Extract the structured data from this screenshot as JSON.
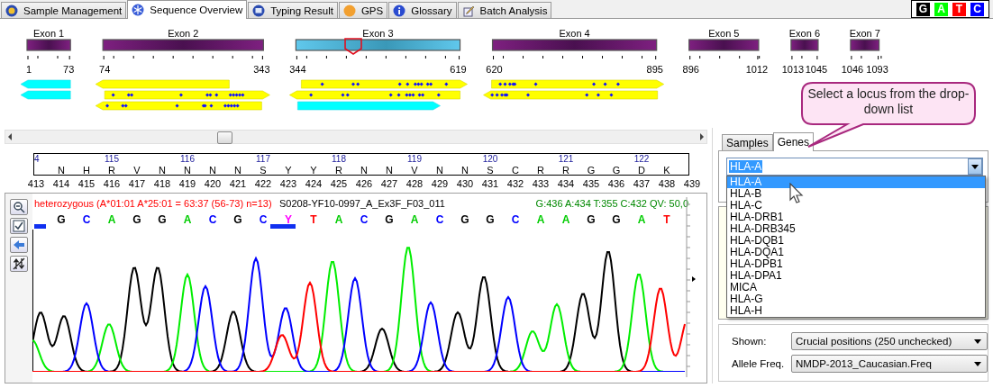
{
  "tabs": [
    {
      "label": "Sample Management",
      "selected": false
    },
    {
      "label": "Sequence Overview",
      "selected": true
    },
    {
      "label": "Typing Result",
      "selected": false
    },
    {
      "label": "GPS",
      "selected": false
    },
    {
      "label": "Glossary",
      "selected": false
    },
    {
      "label": "Batch Analysis",
      "selected": false
    }
  ],
  "base_legend": [
    {
      "label": "G",
      "color": "#000000"
    },
    {
      "label": "A",
      "color": "#00ff00"
    },
    {
      "label": "T",
      "color": "#ff0000"
    },
    {
      "label": "C",
      "color": "#0000ff"
    }
  ],
  "exons": [
    {
      "label": "Exon 1",
      "start": "1",
      "end": "73",
      "selected": false
    },
    {
      "label": "Exon 2",
      "start": "74",
      "end": "343",
      "selected": false
    },
    {
      "label": "Exon 3",
      "start": "344",
      "end": "619",
      "selected": true
    },
    {
      "label": "Exon 4",
      "start": "620",
      "end": "895",
      "selected": false
    },
    {
      "label": "Exon 5",
      "start": "896",
      "end": "1012",
      "selected": false
    },
    {
      "label": "Exon 6",
      "start": "1013",
      "end": "1045",
      "selected": false
    },
    {
      "label": "Exon 7",
      "start": "1046",
      "end": "1093",
      "selected": false
    }
  ],
  "codon_ruler": {
    "codons": [
      "4",
      "115",
      "116",
      "117",
      "118",
      "119",
      "120",
      "121",
      "122"
    ],
    "amino_acids": [
      "N",
      "H",
      "R",
      "V",
      "N",
      "N",
      "N",
      "N",
      "S",
      "Y",
      "Y",
      "R",
      "N",
      "N",
      "V",
      "N",
      "N",
      "S",
      "C",
      "R",
      "R",
      "G",
      "G",
      "D",
      "K"
    ],
    "positions": [
      "413",
      "414",
      "415",
      "416",
      "417",
      "418",
      "419",
      "420",
      "421",
      "422",
      "423",
      "424",
      "425",
      "426",
      "427",
      "428",
      "429",
      "430",
      "431",
      "432",
      "433",
      "434",
      "435",
      "436",
      "437",
      "438",
      "439"
    ]
  },
  "trace": {
    "call": "heterozygous (A*01:01 A*25:01 = 63:37 (56-73) n=13)",
    "sample": "S0208-YF10-0997_A_Ex3F_F03_011",
    "stats": "G:436 A:434 T:355 C:432 QV: 50,0",
    "bases": [
      {
        "letter": "G",
        "color": "#000000"
      },
      {
        "letter": "C",
        "color": "#0000ff"
      },
      {
        "letter": "A",
        "color": "#00cc00"
      },
      {
        "letter": "G",
        "color": "#000000"
      },
      {
        "letter": "G",
        "color": "#000000"
      },
      {
        "letter": "A",
        "color": "#00cc00"
      },
      {
        "letter": "C",
        "color": "#0000ff"
      },
      {
        "letter": "G",
        "color": "#000000"
      },
      {
        "letter": "C",
        "color": "#0000ff"
      },
      {
        "letter": "Y",
        "color": "#ff00ff"
      },
      {
        "letter": "T",
        "color": "#ff0000"
      },
      {
        "letter": "A",
        "color": "#00cc00"
      },
      {
        "letter": "C",
        "color": "#0000ff"
      },
      {
        "letter": "G",
        "color": "#000000"
      },
      {
        "letter": "A",
        "color": "#00cc00"
      },
      {
        "letter": "C",
        "color": "#0000ff"
      },
      {
        "letter": "G",
        "color": "#000000"
      },
      {
        "letter": "G",
        "color": "#000000"
      },
      {
        "letter": "C",
        "color": "#0000ff"
      },
      {
        "letter": "A",
        "color": "#00cc00"
      },
      {
        "letter": "A",
        "color": "#00cc00"
      },
      {
        "letter": "G",
        "color": "#000000"
      },
      {
        "letter": "G",
        "color": "#000000"
      },
      {
        "letter": "A",
        "color": "#00cc00"
      },
      {
        "letter": "T",
        "color": "#ff0000"
      }
    ]
  },
  "right_panel": {
    "callout": "Select a locus from the drop-down list",
    "tabs": [
      {
        "label": "Samples",
        "selected": false
      },
      {
        "label": "Genes",
        "selected": true
      }
    ],
    "locus_field": {
      "value": "HLA-A"
    },
    "locus_options": [
      {
        "label": "HLA-A",
        "selected": true
      },
      {
        "label": "HLA-B",
        "selected": false
      },
      {
        "label": "HLA-C",
        "selected": false
      },
      {
        "label": "HLA-DRB1",
        "selected": false
      },
      {
        "label": "HLA-DRB345",
        "selected": false
      },
      {
        "label": "HLA-DQB1",
        "selected": false
      },
      {
        "label": "HLA-DQA1",
        "selected": false
      },
      {
        "label": "HLA-DPB1",
        "selected": false
      },
      {
        "label": "HLA-DPA1",
        "selected": false
      },
      {
        "label": "MICA",
        "selected": false
      },
      {
        "label": "HLA-G",
        "selected": false
      },
      {
        "label": "HLA-H",
        "selected": false
      }
    ],
    "shown": {
      "label": "Shown:",
      "value": "Crucial positions (250 unchecked)"
    },
    "allele_freq": {
      "label": "Allele Freq.",
      "value": "NMDP-2013_Caucasian.Freq"
    }
  }
}
